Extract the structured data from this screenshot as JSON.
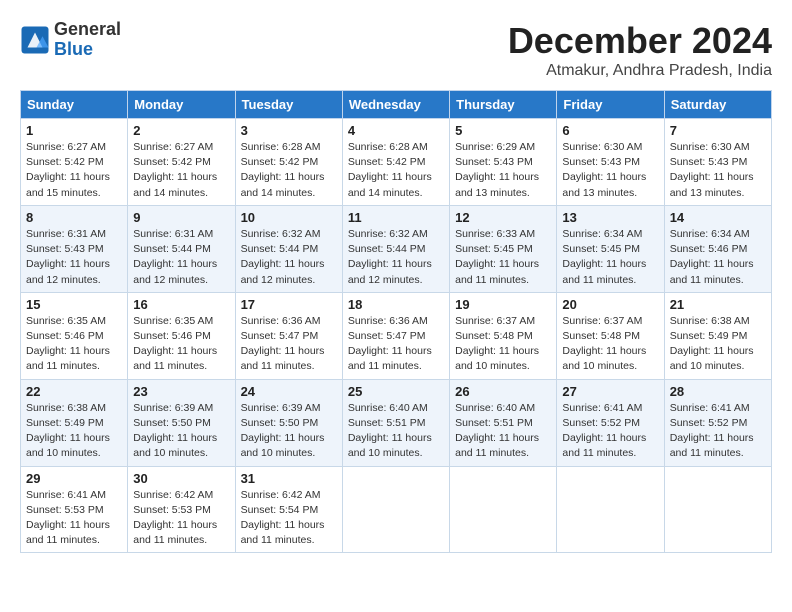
{
  "header": {
    "logo_line1": "General",
    "logo_line2": "Blue",
    "month": "December 2024",
    "location": "Atmakur, Andhra Pradesh, India"
  },
  "columns": [
    "Sunday",
    "Monday",
    "Tuesday",
    "Wednesday",
    "Thursday",
    "Friday",
    "Saturday"
  ],
  "weeks": [
    [
      {
        "day": "1",
        "lines": [
          "Sunrise: 6:27 AM",
          "Sunset: 5:42 PM",
          "Daylight: 11 hours",
          "and 15 minutes."
        ]
      },
      {
        "day": "2",
        "lines": [
          "Sunrise: 6:27 AM",
          "Sunset: 5:42 PM",
          "Daylight: 11 hours",
          "and 14 minutes."
        ]
      },
      {
        "day": "3",
        "lines": [
          "Sunrise: 6:28 AM",
          "Sunset: 5:42 PM",
          "Daylight: 11 hours",
          "and 14 minutes."
        ]
      },
      {
        "day": "4",
        "lines": [
          "Sunrise: 6:28 AM",
          "Sunset: 5:42 PM",
          "Daylight: 11 hours",
          "and 14 minutes."
        ]
      },
      {
        "day": "5",
        "lines": [
          "Sunrise: 6:29 AM",
          "Sunset: 5:43 PM",
          "Daylight: 11 hours",
          "and 13 minutes."
        ]
      },
      {
        "day": "6",
        "lines": [
          "Sunrise: 6:30 AM",
          "Sunset: 5:43 PM",
          "Daylight: 11 hours",
          "and 13 minutes."
        ]
      },
      {
        "day": "7",
        "lines": [
          "Sunrise: 6:30 AM",
          "Sunset: 5:43 PM",
          "Daylight: 11 hours",
          "and 13 minutes."
        ]
      }
    ],
    [
      {
        "day": "8",
        "lines": [
          "Sunrise: 6:31 AM",
          "Sunset: 5:43 PM",
          "Daylight: 11 hours",
          "and 12 minutes."
        ]
      },
      {
        "day": "9",
        "lines": [
          "Sunrise: 6:31 AM",
          "Sunset: 5:44 PM",
          "Daylight: 11 hours",
          "and 12 minutes."
        ]
      },
      {
        "day": "10",
        "lines": [
          "Sunrise: 6:32 AM",
          "Sunset: 5:44 PM",
          "Daylight: 11 hours",
          "and 12 minutes."
        ]
      },
      {
        "day": "11",
        "lines": [
          "Sunrise: 6:32 AM",
          "Sunset: 5:44 PM",
          "Daylight: 11 hours",
          "and 12 minutes."
        ]
      },
      {
        "day": "12",
        "lines": [
          "Sunrise: 6:33 AM",
          "Sunset: 5:45 PM",
          "Daylight: 11 hours",
          "and 11 minutes."
        ]
      },
      {
        "day": "13",
        "lines": [
          "Sunrise: 6:34 AM",
          "Sunset: 5:45 PM",
          "Daylight: 11 hours",
          "and 11 minutes."
        ]
      },
      {
        "day": "14",
        "lines": [
          "Sunrise: 6:34 AM",
          "Sunset: 5:46 PM",
          "Daylight: 11 hours",
          "and 11 minutes."
        ]
      }
    ],
    [
      {
        "day": "15",
        "lines": [
          "Sunrise: 6:35 AM",
          "Sunset: 5:46 PM",
          "Daylight: 11 hours",
          "and 11 minutes."
        ]
      },
      {
        "day": "16",
        "lines": [
          "Sunrise: 6:35 AM",
          "Sunset: 5:46 PM",
          "Daylight: 11 hours",
          "and 11 minutes."
        ]
      },
      {
        "day": "17",
        "lines": [
          "Sunrise: 6:36 AM",
          "Sunset: 5:47 PM",
          "Daylight: 11 hours",
          "and 11 minutes."
        ]
      },
      {
        "day": "18",
        "lines": [
          "Sunrise: 6:36 AM",
          "Sunset: 5:47 PM",
          "Daylight: 11 hours",
          "and 11 minutes."
        ]
      },
      {
        "day": "19",
        "lines": [
          "Sunrise: 6:37 AM",
          "Sunset: 5:48 PM",
          "Daylight: 11 hours",
          "and 10 minutes."
        ]
      },
      {
        "day": "20",
        "lines": [
          "Sunrise: 6:37 AM",
          "Sunset: 5:48 PM",
          "Daylight: 11 hours",
          "and 10 minutes."
        ]
      },
      {
        "day": "21",
        "lines": [
          "Sunrise: 6:38 AM",
          "Sunset: 5:49 PM",
          "Daylight: 11 hours",
          "and 10 minutes."
        ]
      }
    ],
    [
      {
        "day": "22",
        "lines": [
          "Sunrise: 6:38 AM",
          "Sunset: 5:49 PM",
          "Daylight: 11 hours",
          "and 10 minutes."
        ]
      },
      {
        "day": "23",
        "lines": [
          "Sunrise: 6:39 AM",
          "Sunset: 5:50 PM",
          "Daylight: 11 hours",
          "and 10 minutes."
        ]
      },
      {
        "day": "24",
        "lines": [
          "Sunrise: 6:39 AM",
          "Sunset: 5:50 PM",
          "Daylight: 11 hours",
          "and 10 minutes."
        ]
      },
      {
        "day": "25",
        "lines": [
          "Sunrise: 6:40 AM",
          "Sunset: 5:51 PM",
          "Daylight: 11 hours",
          "and 10 minutes."
        ]
      },
      {
        "day": "26",
        "lines": [
          "Sunrise: 6:40 AM",
          "Sunset: 5:51 PM",
          "Daylight: 11 hours",
          "and 11 minutes."
        ]
      },
      {
        "day": "27",
        "lines": [
          "Sunrise: 6:41 AM",
          "Sunset: 5:52 PM",
          "Daylight: 11 hours",
          "and 11 minutes."
        ]
      },
      {
        "day": "28",
        "lines": [
          "Sunrise: 6:41 AM",
          "Sunset: 5:52 PM",
          "Daylight: 11 hours",
          "and 11 minutes."
        ]
      }
    ],
    [
      {
        "day": "29",
        "lines": [
          "Sunrise: 6:41 AM",
          "Sunset: 5:53 PM",
          "Daylight: 11 hours",
          "and 11 minutes."
        ]
      },
      {
        "day": "30",
        "lines": [
          "Sunrise: 6:42 AM",
          "Sunset: 5:53 PM",
          "Daylight: 11 hours",
          "and 11 minutes."
        ]
      },
      {
        "day": "31",
        "lines": [
          "Sunrise: 6:42 AM",
          "Sunset: 5:54 PM",
          "Daylight: 11 hours",
          "and 11 minutes."
        ]
      },
      null,
      null,
      null,
      null
    ]
  ]
}
